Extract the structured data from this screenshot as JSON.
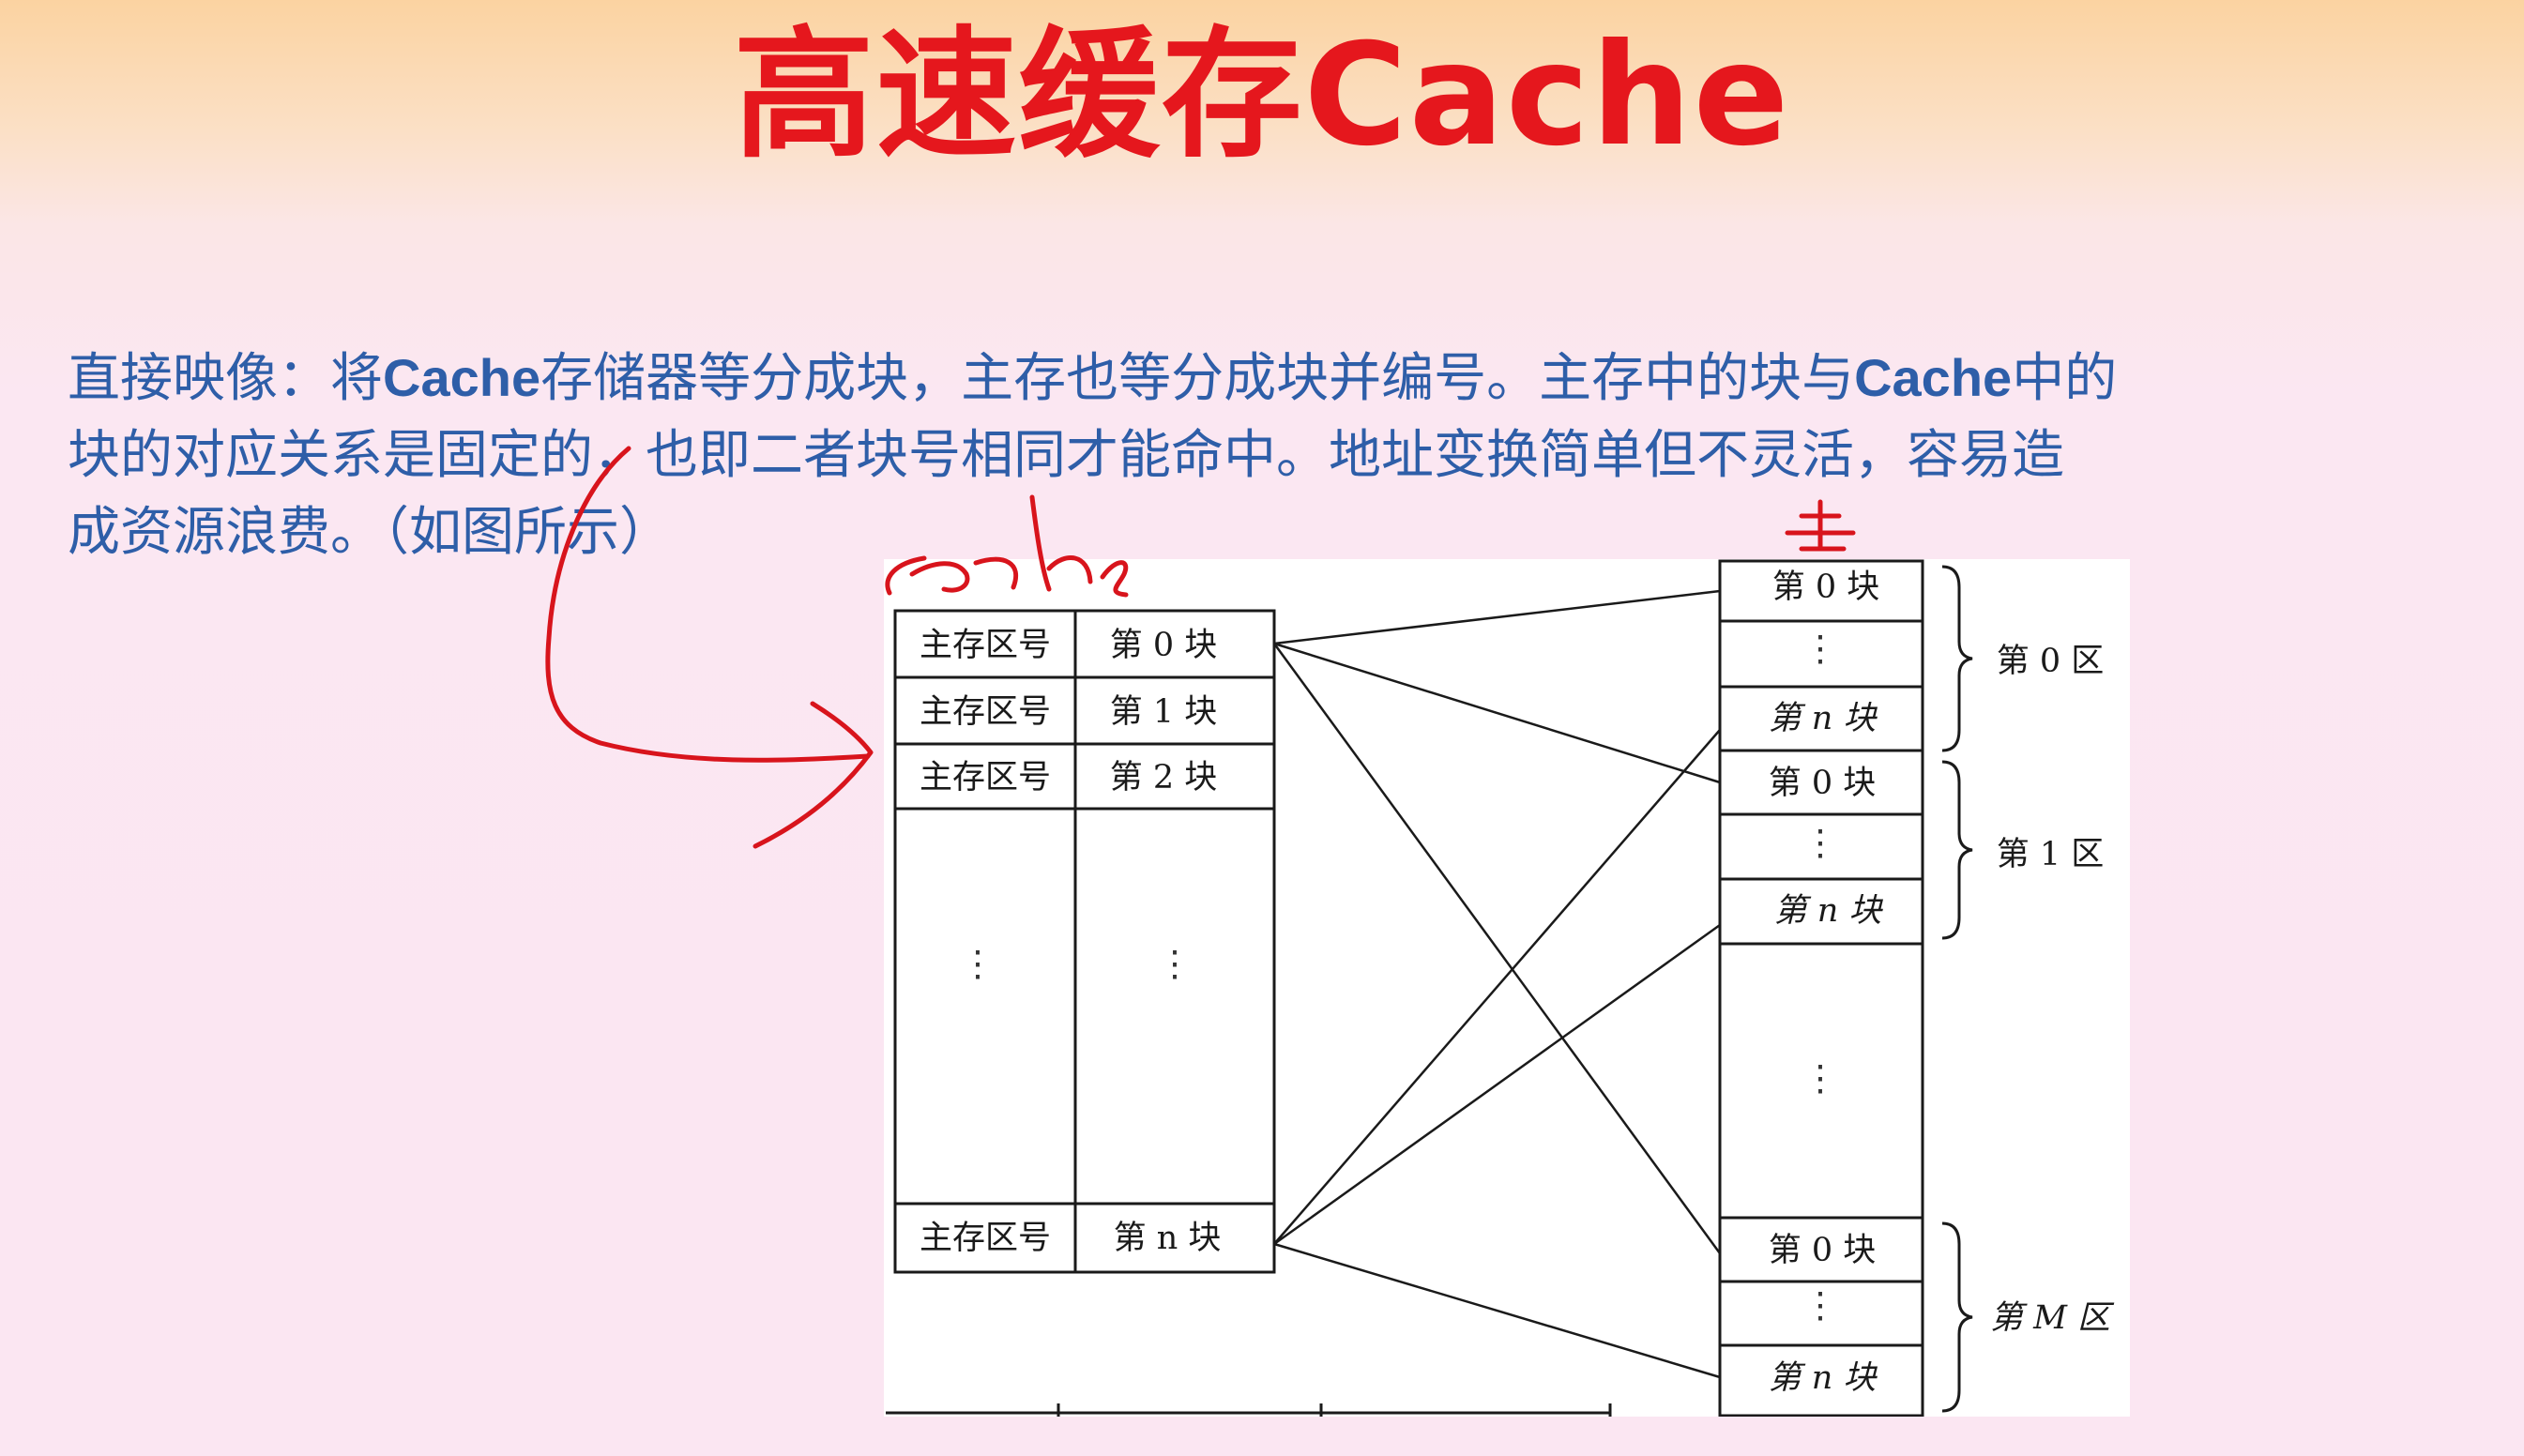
{
  "title": "高速缓存Cache",
  "paragraph": {
    "line1_a": "直接映像：将",
    "line1_b": "Cache",
    "line1_c": "存储器等分成块，主存也等分成块并编号。主存中的块与",
    "line1_d": "Cache",
    "line1_e": "中的",
    "line2": "块的对应关系是固定的，也即二者块号相同才能命中。地址变换简单但不灵活，容易造",
    "line3": "成资源浪费。（如图所示）"
  },
  "cache_table": {
    "rows": [
      {
        "tag": "主存区号",
        "block": "第 0 块"
      },
      {
        "tag": "主存区号",
        "block": "第 1 块"
      },
      {
        "tag": "主存区号",
        "block": "第 2 块"
      },
      {
        "tag": "⋮",
        "block": "⋮"
      },
      {
        "tag": "主存区号",
        "block": "第 n 块"
      }
    ]
  },
  "main_memory": {
    "zone0": {
      "label": "第 0 区",
      "first": "第 0 块",
      "dots": "⋮",
      "last": "第 n 块"
    },
    "zone1": {
      "label": "第 1 区",
      "first": "第 0 块",
      "dots": "⋮",
      "last": "第 n 块"
    },
    "gap_dots": "⋮",
    "zoneM": {
      "label": "第 M 区",
      "first": "第 0 块",
      "dots": "⋮",
      "last": "第 n 块"
    }
  },
  "colors": {
    "title": "#e5171d",
    "paragraph": "#2e5ea8",
    "ink": "#d8141c"
  }
}
